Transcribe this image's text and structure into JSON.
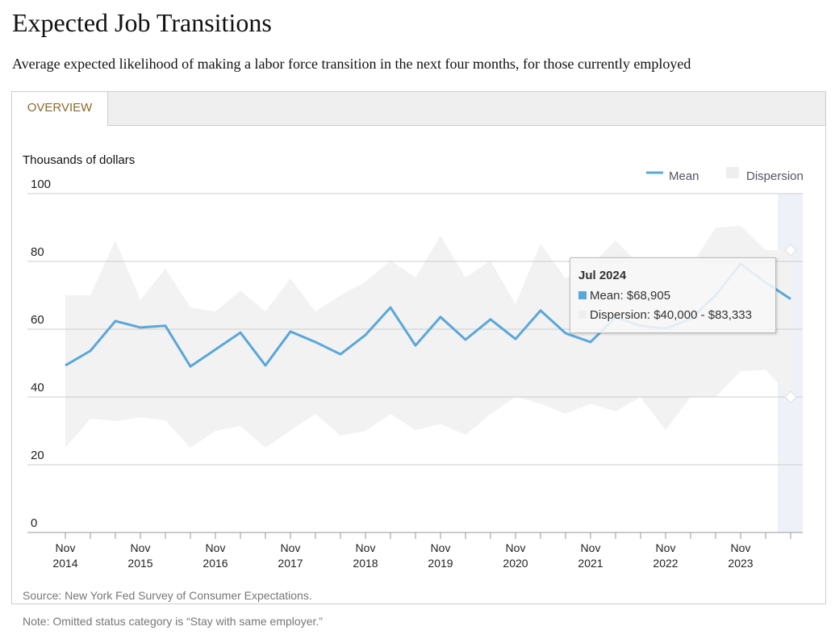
{
  "title": "Expected Job Transitions",
  "subtitle": "Average expected likelihood of making a labor force transition in the next four months, for those currently employed",
  "tabs": [
    {
      "label": "OVERVIEW",
      "active": true
    }
  ],
  "source": "Source: New York Fed Survey of Consumer Expectations.",
  "note": "Note: Omitted status category is “Stay with same employer.”",
  "tooltip": {
    "title": "Jul 2024",
    "mean": "Mean: $68,905",
    "dispersion": "Dispersion: $40,000 - $83,333"
  },
  "colors": {
    "mean": "#5aa7d9",
    "dispersion": "#f2f2f2",
    "highlight": "#eef2f8"
  },
  "chart_data": {
    "type": "area",
    "ylabel": "Thousands of dollars",
    "ylim": [
      0,
      100
    ],
    "yticks": [
      0,
      20,
      40,
      60,
      80,
      100
    ],
    "grid": true,
    "legend_placement": "top-right",
    "xtick_labels": [
      [
        "Nov",
        "2014"
      ],
      [
        "Nov",
        "2015"
      ],
      [
        "Nov",
        "2016"
      ],
      [
        "Nov",
        "2017"
      ],
      [
        "Nov",
        "2018"
      ],
      [
        "Nov",
        "2019"
      ],
      [
        "Nov",
        "2020"
      ],
      [
        "Nov",
        "2021"
      ],
      [
        "Nov",
        "2022"
      ],
      [
        "Nov",
        "2023"
      ]
    ],
    "x": [
      "Nov 2014",
      "Mar 2015",
      "Jul 2015",
      "Nov 2015",
      "Mar 2016",
      "Jul 2016",
      "Nov 2016",
      "Mar 2017",
      "Jul 2017",
      "Nov 2017",
      "Mar 2018",
      "Jul 2018",
      "Nov 2018",
      "Mar 2019",
      "Jul 2019",
      "Nov 2019",
      "Mar 2020",
      "Jul 2020",
      "Nov 2020",
      "Mar 2021",
      "Jul 2021",
      "Nov 2021",
      "Mar 2022",
      "Jul 2022",
      "Nov 2022",
      "Mar 2023",
      "Jul 2023",
      "Nov 2023",
      "Mar 2024",
      "Jul 2024"
    ],
    "series": [
      {
        "name": "Mean",
        "values": [
          49.3,
          53.6,
          62.4,
          60.5,
          61,
          49,
          54,
          59,
          49.3,
          59.3,
          56.2,
          52.6,
          58.3,
          66.4,
          55.2,
          63.6,
          56.9,
          62.9,
          57.1,
          65.5,
          58.8,
          56.2,
          63.5,
          61,
          60.2,
          63,
          70,
          79.3,
          73.8,
          68.9
        ]
      },
      {
        "name": "Dispersion",
        "low": [
          25,
          33.6,
          32.9,
          34,
          33.1,
          25,
          30,
          31.4,
          25,
          30,
          35,
          28.6,
          30,
          35,
          30.2,
          32,
          28.8,
          35,
          40,
          38,
          35,
          38,
          35.7,
          40,
          30.2,
          40,
          40,
          47.6,
          48,
          40
        ],
        "high": [
          70,
          70,
          86.2,
          68.6,
          77.9,
          66.4,
          65.2,
          71.4,
          65.2,
          75,
          65.2,
          70,
          74,
          80.2,
          75.2,
          87.6,
          75.2,
          80.2,
          67.4,
          85.2,
          75,
          78.6,
          86.2,
          78.6,
          78.6,
          78.6,
          90,
          90.5,
          83.3,
          83.3
        ]
      }
    ]
  }
}
